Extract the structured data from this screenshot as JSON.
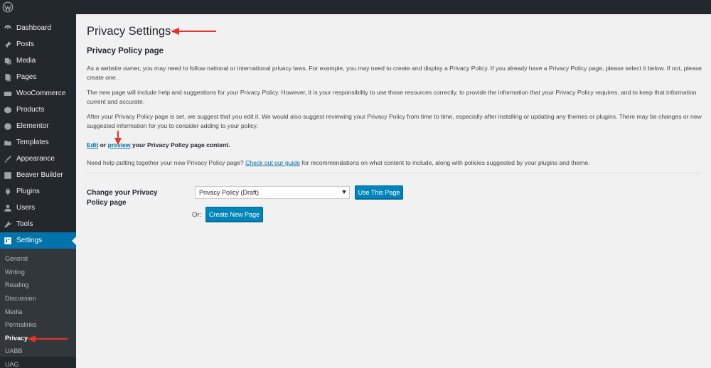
{
  "sidebar": {
    "menu": [
      {
        "label": "Dashboard",
        "icon": "dashboard-icon"
      },
      {
        "label": "Posts",
        "icon": "pushpin-icon"
      },
      {
        "label": "Media",
        "icon": "media-icon"
      },
      {
        "label": "Pages",
        "icon": "pages-icon"
      },
      {
        "label": "WooCommerce",
        "icon": "woocommerce-icon"
      },
      {
        "label": "Products",
        "icon": "products-icon"
      },
      {
        "label": "Elementor",
        "icon": "elementor-icon"
      },
      {
        "label": "Templates",
        "icon": "folder-icon"
      },
      {
        "label": "Appearance",
        "icon": "paintbrush-icon"
      },
      {
        "label": "Beaver Builder",
        "icon": "beaver-builder-icon"
      },
      {
        "label": "Plugins",
        "icon": "plugin-icon"
      },
      {
        "label": "Users",
        "icon": "users-icon"
      },
      {
        "label": "Tools",
        "icon": "wrench-icon"
      },
      {
        "label": "Settings",
        "icon": "settings-icon"
      }
    ],
    "submenu": [
      "General",
      "Writing",
      "Reading",
      "Discussion",
      "Media",
      "Permalinks",
      "Privacy",
      "UABB",
      "UAG"
    ]
  },
  "page": {
    "title": "Privacy Settings",
    "section_title": "Privacy Policy page",
    "p1": "As a website owner, you may need to follow national or international privacy laws. For example, you may need to create and display a Privacy Policy. If you already have a Privacy Policy page, please select it below. If not, please create one.",
    "p2": "The new page will include help and suggestions for your Privacy Policy. However, it is your responsibility to use those resources correctly, to provide the information that your Privacy Policy requires, and to keep that information current and accurate.",
    "p3": "After your Privacy Policy page is set, we suggest that you edit it. We would also suggest reviewing your Privacy Policy from time to time, especially after installing or updating any themes or plugins. There may be changes or new suggested information for you to consider adding to your policy.",
    "p4": {
      "edit": "Edit",
      "or": " or ",
      "preview": "preview",
      "rest": " your Privacy Policy page content."
    },
    "p5": {
      "before": "Need help putting together your new Privacy Policy page? ",
      "link": "Check out our guide",
      "after": " for recommendations on what content to include, along with policies suggested by your plugins and theme."
    },
    "form": {
      "label": "Change your Privacy Policy page",
      "selected": "Privacy Policy (Draft)",
      "use_button": "Use This Page",
      "or": "Or:",
      "create_button": "Create New Page"
    }
  },
  "colors": {
    "accent": "#0073aa",
    "annotation": "#e8332a",
    "sidebar_bg": "#23282d"
  }
}
